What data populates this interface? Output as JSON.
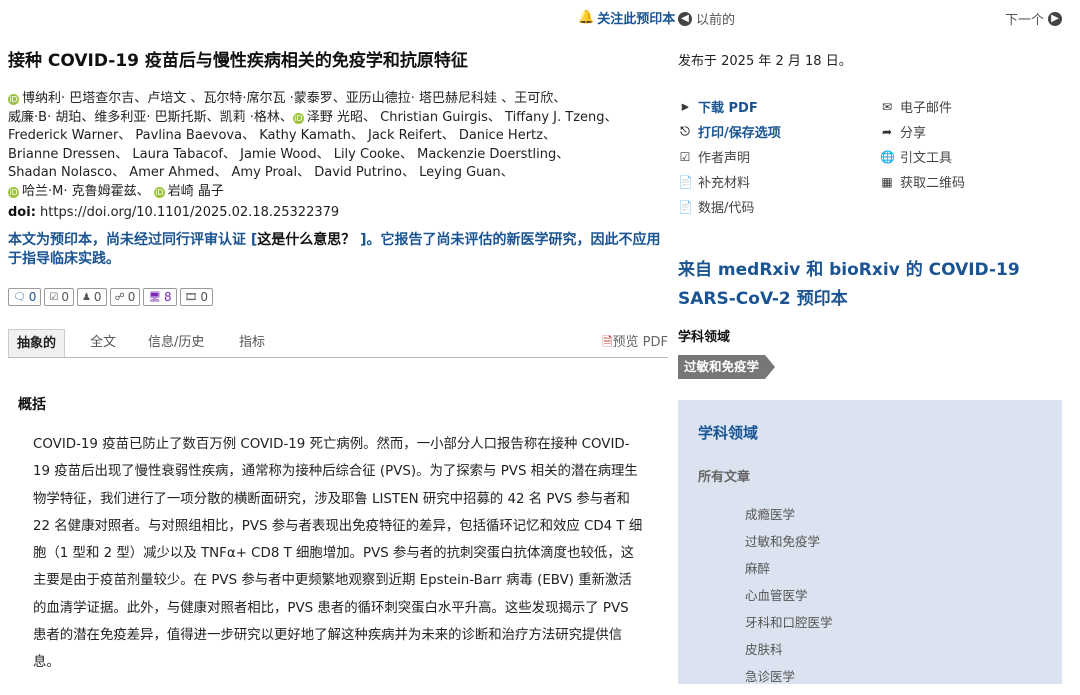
{
  "topbar": {
    "follow_label": "关注此预印本",
    "prev_label": "以前的",
    "next_label": "下一个"
  },
  "article": {
    "title": "接种 COVID-19 疫苗后与慢性疾病相关的免疫学和抗原特征",
    "authors_line1_a": "博纳利· 巴塔查尔吉、卢培文 、瓦尔特·席尔瓦 ·蒙泰罗、亚历山德拉· 塔巴赫尼科娃 、王可欣、",
    "authors_line2_a": "威廉·B· 胡珀、维多利亚· 巴斯托斯、凯莉 ·格林、",
    "authors_line2_b": "泽野 光昭、 Christian Guirgis、 Tiffany J. Tzeng、",
    "authors_line3": "Frederick Warner、 Pavlina Baevova、 Kathy Kamath、 Jack Reifert、 Danice Hertz、",
    "authors_line4": "Brianne Dressen、 Laura Tabacof、 Jamie Wood、 Lily Cooke、 Mackenzie Doerstling、",
    "authors_line5": "Shadan Nolasco、 Amer Ahmed、 Amy Proal、 David Putrino、 Leying Guan、",
    "authors_line6_a": "哈兰·M· 克鲁姆霍兹、",
    "authors_line6_b": "岩崎 晶子",
    "doi_label": "doi:",
    "doi_value": " https://doi.org/10.1101/2025.02.18.25322379",
    "preprint_notice_a": "本文为预印本，尚未经过同行评审认证 [",
    "preprint_notice_q": "这是什么意思？",
    "preprint_notice_b": " ]。它报告了尚未评估的新医学研究，因此不应用于指导临床实践。"
  },
  "counters": [
    {
      "icon": "comment-icon",
      "value": "0"
    },
    {
      "icon": "review-icon",
      "value": "0"
    },
    {
      "icon": "users-icon",
      "value": "0"
    },
    {
      "icon": "share-nodes-icon",
      "value": "0"
    },
    {
      "icon": "monitor-icon",
      "value": "8"
    },
    {
      "icon": "film-icon",
      "value": "0"
    }
  ],
  "tabs": {
    "abstract": "抽象的",
    "fulltext": "全文",
    "info": "信息/历史",
    "metrics": "指标",
    "preview_pdf": "预览 PDF"
  },
  "abstract": {
    "heading": "概括",
    "text": "COVID-19 疫苗已防止了数百万例 COVID-19 死亡病例。然而，一小部分人口报告称在接种 COVID-19 疫苗后出现了慢性衰弱性疾病，通常称为接种后综合征 (PVS)。为了探索与 PVS 相关的潜在病理生物学特征，我们进行了一项分散的横断面研究，涉及耶鲁 LISTEN 研究中招募的 42 名 PVS 参与者和 22 名健康对照者。与对照组相比，PVS 参与者表现出免疫特征的差异，包括循环记忆和效应 CD4 T 细胞（1 型和 2 型）减少以及 TNFα+ CD8 T 细胞增加。PVS 参与者的抗刺突蛋白抗体滴度也较低，这主要是由于疫苗剂量较少。在 PVS 参与者中更频繁地观察到近期 Epstein-Barr 病毒 (EBV) 重新激活的血清学证据。此外，与健康对照者相比，PVS 患者的循环刺突蛋白水平升高。这些发现揭示了 PVS 患者的潜在免疫差异，值得进一步研究以更好地了解这种疾病并为未来的诊断和治疗方法研究提供信息。"
  },
  "sidebar": {
    "posted": "发布于 2025 年 2 月 18 日。",
    "actions": {
      "download_pdf": "下载 PDF",
      "print_save": "打印/保存选项",
      "author_statement": "作者声明",
      "supplementary": "补充材料",
      "data_code": "数据/代码",
      "email": "电子邮件",
      "share": "分享",
      "cite": "引文工具",
      "qr": "获取二维码"
    },
    "covid_heading": "来自 medRxiv 和 bioRxiv 的 COVID-19 SARS-CoV-2 预印本",
    "field_label": "学科领域",
    "field_tag": "过敏和免疫学",
    "subject_box": {
      "title": "学科领域",
      "all_articles": "所有文章",
      "items": [
        "成瘾医学",
        "过敏和免疫学",
        "麻醉",
        "心血管医学",
        "牙科和口腔医学",
        "皮肤科",
        "急诊医学"
      ]
    }
  }
}
